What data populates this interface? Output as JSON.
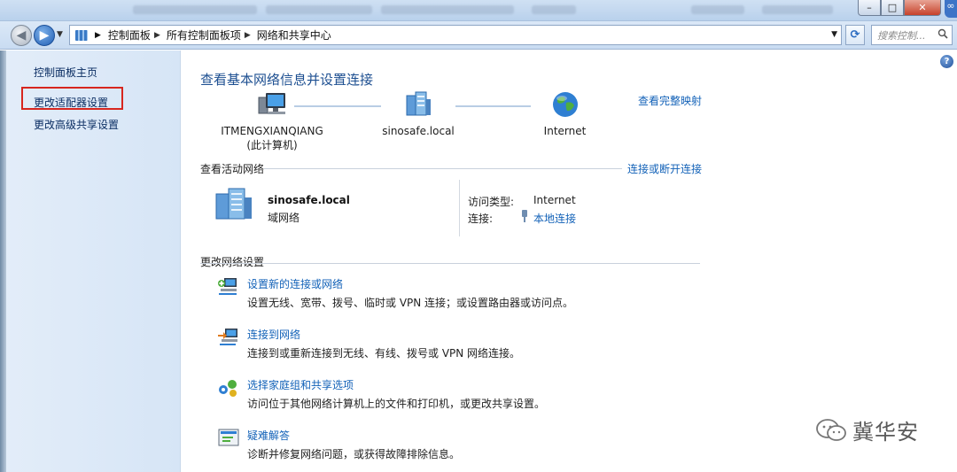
{
  "address": {
    "crumbs": [
      "控制面板",
      "所有控制面板项",
      "网络和共享中心"
    ],
    "search_placeholder": "搜索控制..."
  },
  "sidebar": {
    "items": [
      {
        "label": "控制面板主页"
      },
      {
        "label": "更改适配器设置",
        "highlighted": true
      },
      {
        "label": "更改高级共享设置"
      }
    ]
  },
  "main": {
    "title": "查看基本网络信息并设置连接",
    "full_map_link": "查看完整映射",
    "map": {
      "computer_name": "ITMENGXIANQIANG",
      "computer_sub": "(此计算机)",
      "domain_node": "sinosafe.local",
      "internet_node": "Internet"
    },
    "active": {
      "heading": "查看活动网络",
      "connect_link": "连接或断开连接",
      "network_name": "sinosafe.local",
      "network_category": "域网络",
      "access_type_label": "访问类型:",
      "access_type_value": "Internet",
      "connection_label": "连接:",
      "connection_value": "本地连接"
    },
    "settings": {
      "heading": "更改网络设置",
      "tasks": [
        {
          "link": "设置新的连接或网络",
          "desc": "设置无线、宽带、拨号、临时或 VPN 连接；或设置路由器或访问点。",
          "icon": "new-connection-icon"
        },
        {
          "link": "连接到网络",
          "desc": "连接到或重新连接到无线、有线、拨号或 VPN 网络连接。",
          "icon": "connect-network-icon"
        },
        {
          "link": "选择家庭组和共享选项",
          "desc": "访问位于其他网络计算机上的文件和打印机，或更改共享设置。",
          "icon": "homegroup-icon"
        },
        {
          "link": "疑难解答",
          "desc": "诊断并修复网络问题，或获得故障排除信息。",
          "icon": "troubleshoot-icon"
        }
      ]
    }
  },
  "watermark": {
    "text": "冀华安"
  }
}
